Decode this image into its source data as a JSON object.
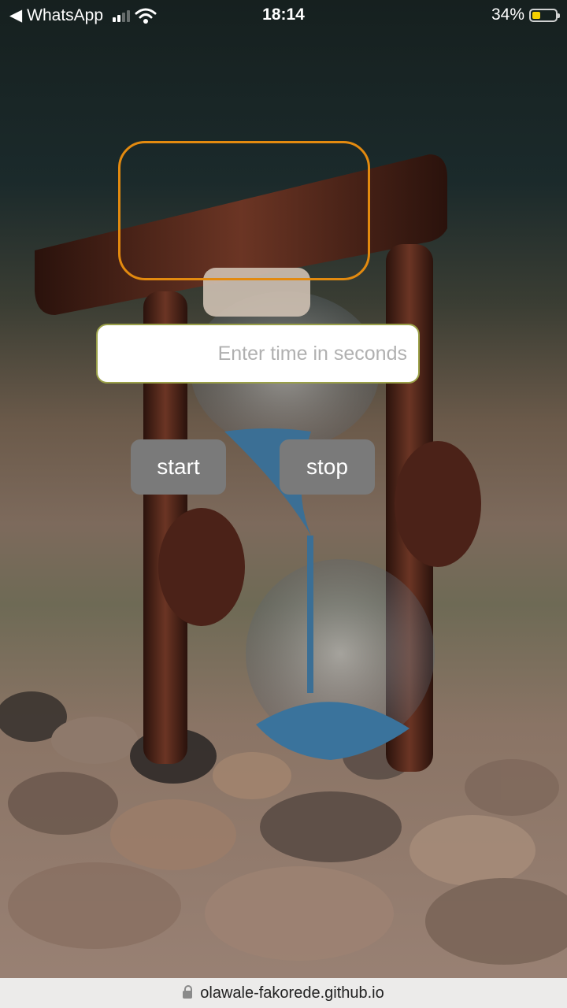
{
  "status_bar": {
    "back_app": "WhatsApp",
    "time": "18:14",
    "battery": "34%",
    "battery_level": 0.34
  },
  "timer": {
    "input_placeholder": "Enter time in seconds",
    "input_value": "",
    "start_label": "start",
    "stop_label": "stop"
  },
  "browser": {
    "url": "olawale-fakorede.github.io"
  },
  "colors": {
    "frame_border": "#e38a0f",
    "button_bg": "#7a7a7a",
    "battery_fill": "#f5d000"
  }
}
